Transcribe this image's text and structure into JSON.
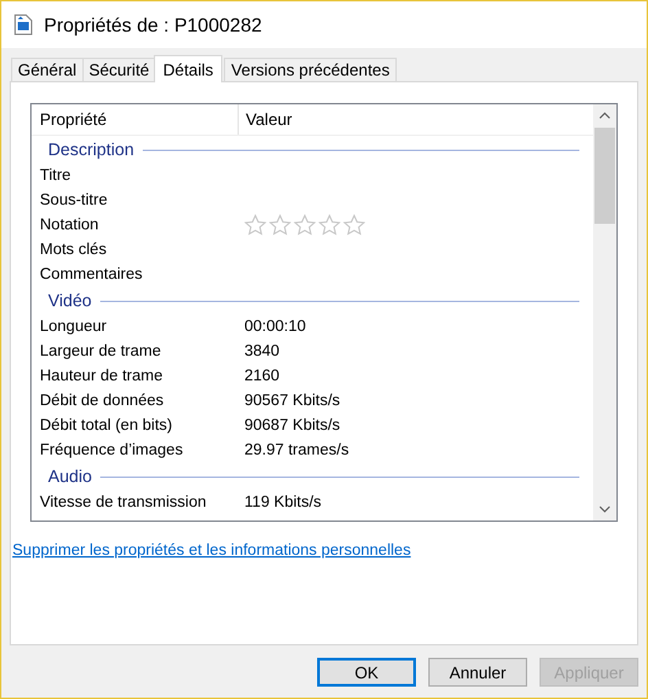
{
  "window": {
    "title": "Propriétés de : P1000282"
  },
  "tabs": [
    {
      "label": "Général",
      "selected": false
    },
    {
      "label": "Sécurité",
      "selected": false
    },
    {
      "label": "Détails",
      "selected": true
    },
    {
      "label": "Versions précédentes",
      "selected": false
    }
  ],
  "table": {
    "columns": [
      "Propriété",
      "Valeur"
    ],
    "sections": [
      {
        "title": "Description",
        "rows": [
          {
            "kind": "text",
            "name": "Titre"
          },
          {
            "kind": "text",
            "name": "Sous-titre"
          },
          {
            "kind": "rating",
            "name": "Notation",
            "stars": 0
          },
          {
            "kind": "text",
            "name": "Mots clés"
          },
          {
            "kind": "text",
            "name": "Commentaires"
          }
        ]
      },
      {
        "title": "Vidéo",
        "rows": [
          {
            "kind": "text",
            "name": "Longueur",
            "value": "00:00:10"
          },
          {
            "kind": "text",
            "name": "Largeur de trame",
            "value": "3840"
          },
          {
            "kind": "text",
            "name": "Hauteur de trame",
            "value": "2160"
          },
          {
            "kind": "text",
            "name": "Débit de données",
            "value": "90567 Kbits/s"
          },
          {
            "kind": "text",
            "name": "Débit total (en bits)",
            "value": "90687 Kbits/s"
          },
          {
            "kind": "text",
            "name": "Fréquence d’images",
            "value": "29.97 trames/s"
          }
        ]
      },
      {
        "title": "Audio",
        "rows": [
          {
            "kind": "text",
            "name": "Vitesse de transmission",
            "value": "119 Kbits/s"
          }
        ]
      }
    ]
  },
  "link": "Supprimer les propriétés et les informations personnelles",
  "buttons": [
    {
      "label": "OK",
      "default": true,
      "disabled": false
    },
    {
      "label": "Annuler",
      "default": false,
      "disabled": false
    },
    {
      "label": "Appliquer",
      "default": false,
      "disabled": true
    }
  ]
}
